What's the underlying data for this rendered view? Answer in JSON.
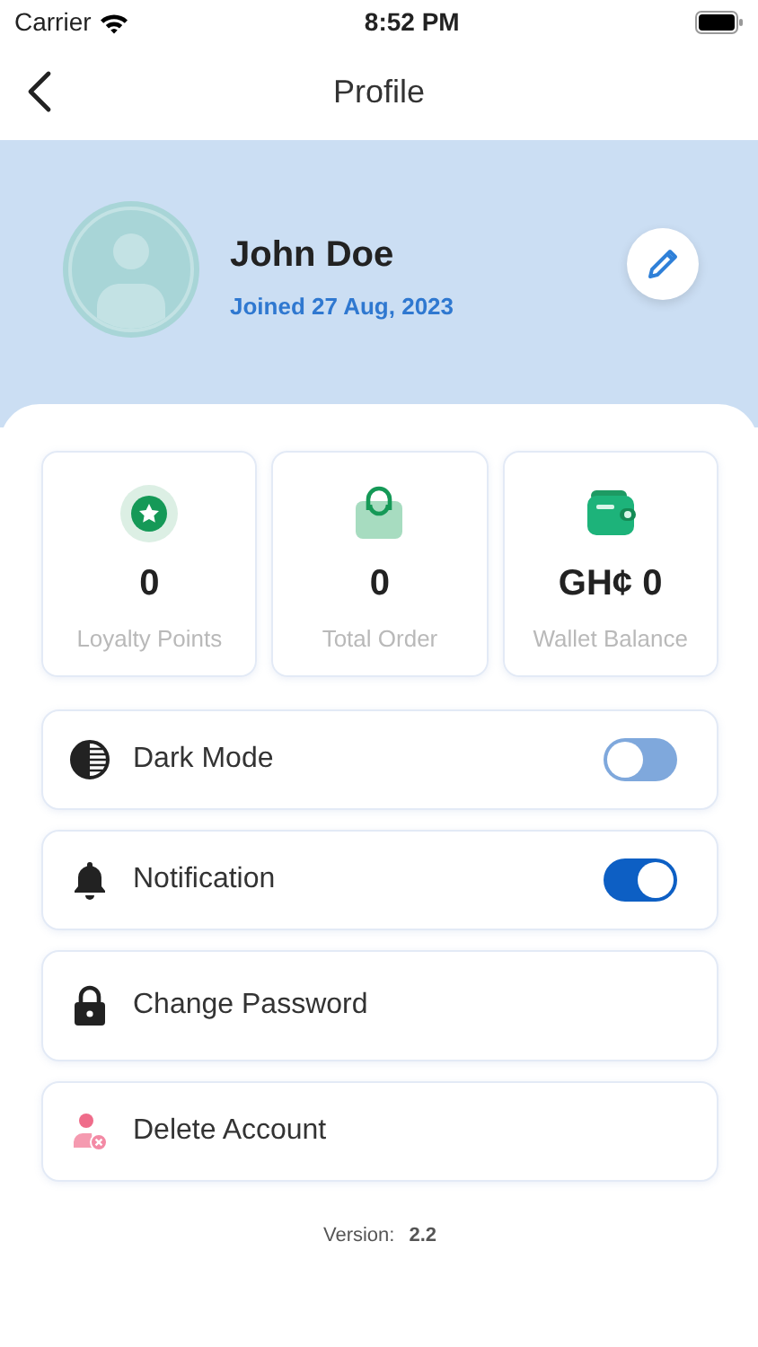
{
  "status_bar": {
    "carrier": "Carrier",
    "time": "8:52 PM"
  },
  "nav": {
    "title": "Profile"
  },
  "profile": {
    "name": "John Doe",
    "joined": "Joined 27 Aug, 2023"
  },
  "stats": [
    {
      "value": "0",
      "label": "Loyalty Points"
    },
    {
      "value": "0",
      "label": "Total Order"
    },
    {
      "value": "GH¢ 0",
      "label": "Wallet Balance"
    }
  ],
  "settings": [
    {
      "kind": "toggle",
      "label": "Dark Mode",
      "on": false
    },
    {
      "kind": "toggle",
      "label": "Notification",
      "on": true
    },
    {
      "kind": "link",
      "label": "Change Password"
    },
    {
      "kind": "link",
      "label": "Delete Account"
    }
  ],
  "version": {
    "label": "Version:",
    "value": "2.2"
  }
}
